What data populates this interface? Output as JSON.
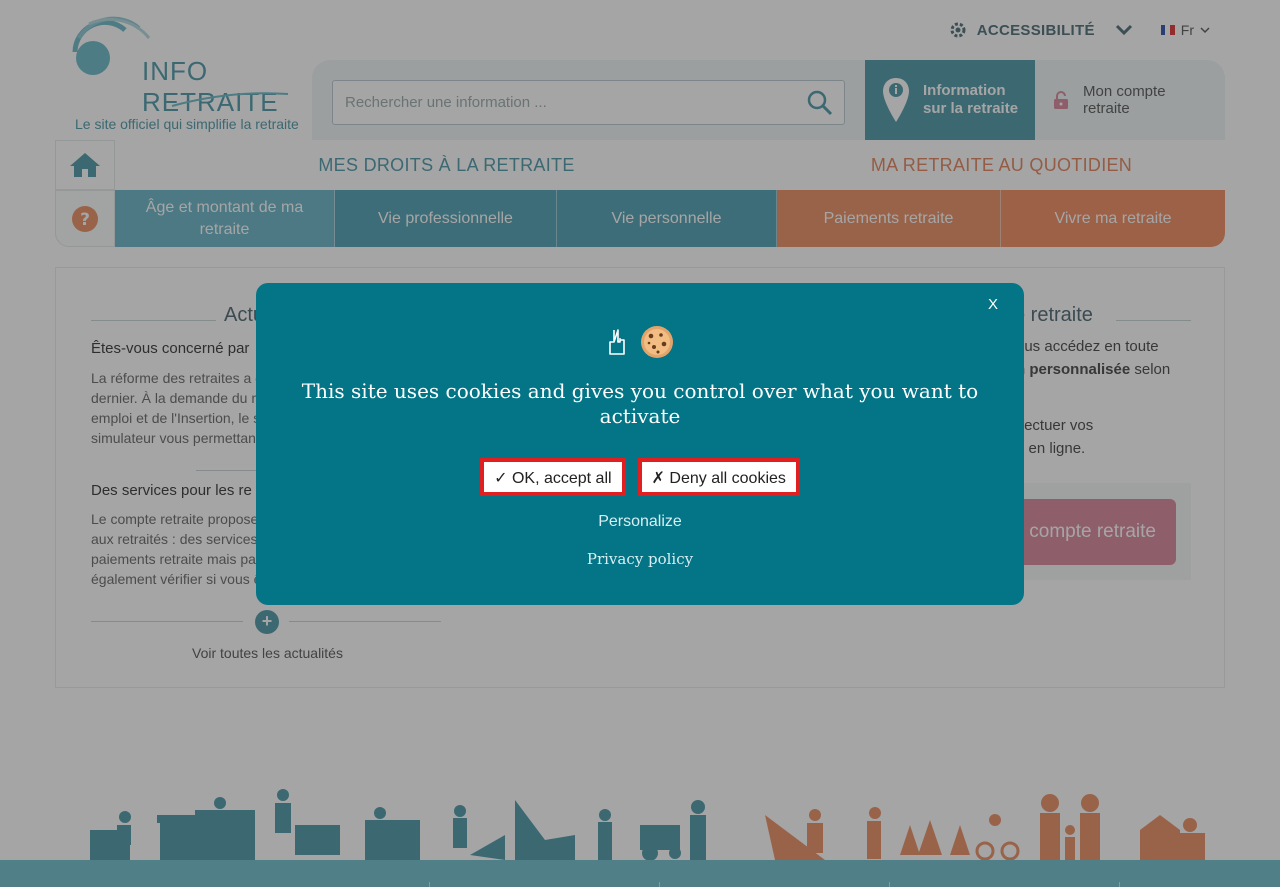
{
  "header": {
    "logo_text": "INFO RETRAITE",
    "tagline": "Le site officiel qui simplifie la retraite",
    "accessibility_label": "ACCESSIBILITÉ",
    "lang_label": "Fr",
    "search_placeholder": "Rechercher une information ...",
    "info_tab": {
      "line1": "Information",
      "line2": "sur la retraite"
    },
    "account_tab": {
      "line1": "Mon compte",
      "line2": "retraite"
    }
  },
  "nav": {
    "heading_left": "MES DROITS À LA RETRAITE",
    "heading_right": "MA RETRAITE AU QUOTIDIEN",
    "items": [
      {
        "label": "Âge et montant de ma retraite"
      },
      {
        "label": "Vie professionnelle"
      },
      {
        "label": "Vie personnelle"
      },
      {
        "label": "Paiements retraite"
      },
      {
        "label": "Vivre ma retraite"
      }
    ]
  },
  "content": {
    "left_title": "Actu",
    "news": [
      {
        "title": "Êtes-vous concerné par",
        "body": [
          "La réforme des retraites a é",
          "dernier. À la demande du m",
          "emploi et de l'Insertion, le si",
          "simulateur vous permettant"
        ]
      },
      {
        "title": "Des services pour les re",
        "body": [
          "Le compte retraite propose",
          "aux retraités : des services",
          "paiements retraite mais pas",
          "également vérifier si vous ê"
        ]
      }
    ],
    "see_all": "Voir toutes les actualités",
    "right_title": "e retraite",
    "right_lines": [
      {
        "pre": "ous accédez en toute",
        "bold": "",
        "post": ""
      },
      {
        "pre": "",
        "bold": "n personnalisée",
        "post": " selon"
      },
      {
        "pre": "ffectuer vos",
        "bold": "",
        "post": ""
      },
      {
        "pre": "",
        "bold": "s",
        "post": " en ligne."
      }
    ],
    "account_button": "compte retraite"
  },
  "cookie_modal": {
    "close": "X",
    "message": "This site uses cookies and gives you control over what you want to activate",
    "accept_label": "✓ OK, accept all",
    "deny_label": "✗ Deny all cookies",
    "personalize_label": "Personalize",
    "privacy_label": "Privacy policy"
  },
  "colors": {
    "teal": "#4a97a8",
    "orange": "#e2825a",
    "modal": "#037586",
    "account_pink": "#d9859c"
  }
}
